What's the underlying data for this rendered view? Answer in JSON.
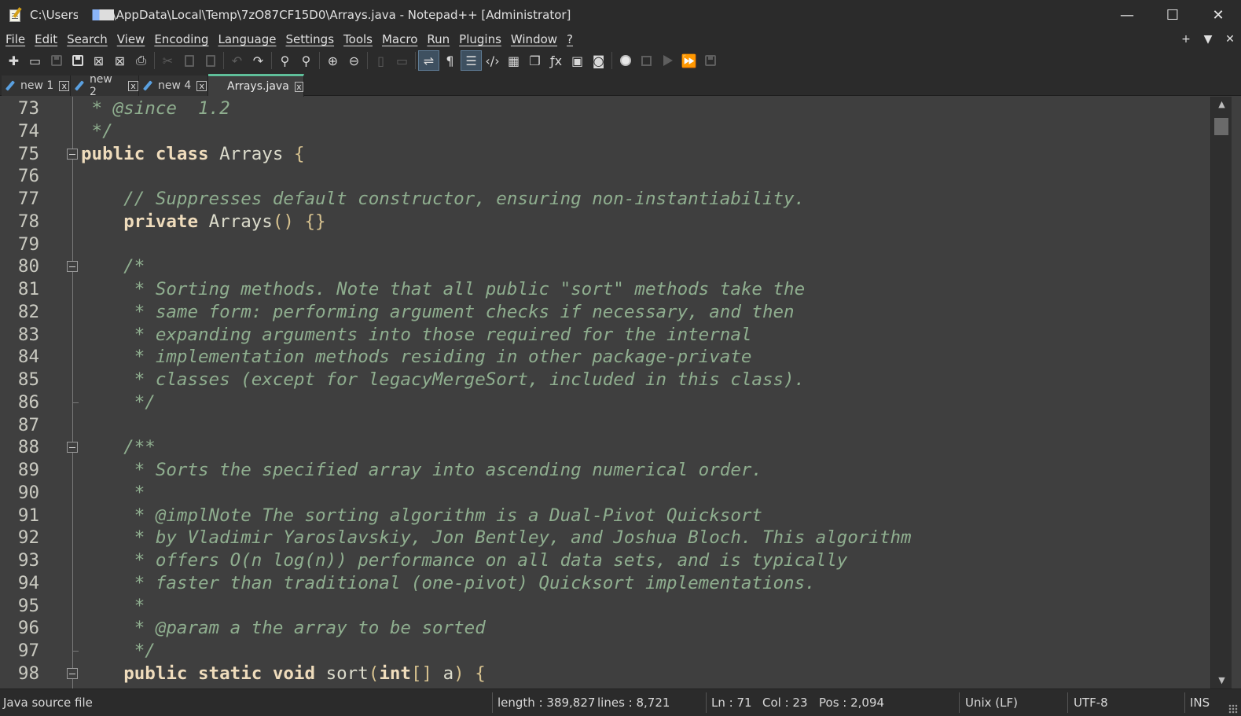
{
  "window": {
    "title_prefix": "C:\\Users",
    "title_suffix": "\\AppData\\Local\\Temp\\7zO87CF15D0\\Arrays.java - Notepad++ [Administrator]",
    "minimize": "—",
    "maximize": "☐",
    "close": "✕"
  },
  "menu": {
    "items": [
      "File",
      "Edit",
      "Search",
      "View",
      "Encoding",
      "Language",
      "Settings",
      "Tools",
      "Macro",
      "Run",
      "Plugins",
      "Window",
      "?"
    ],
    "right_plus": "+",
    "right_down": "▼",
    "right_close": "✕"
  },
  "toolbar": {
    "icons": [
      "new-file-icon",
      "open-file-icon",
      "save-icon",
      "save-all-icon",
      "close-icon",
      "close-all-icon",
      "print-icon",
      "cut-icon",
      "copy-icon",
      "paste-icon",
      "undo-icon",
      "redo-icon",
      "find-icon",
      "replace-icon",
      "zoom-in-icon",
      "zoom-out-icon",
      "sync-vertical-icon",
      "sync-horizontal-icon",
      "word-wrap-icon",
      "show-all-chars-icon",
      "indent-guide-icon",
      "xml-tag-icon",
      "document-map-icon",
      "document-list-icon",
      "function-list-icon",
      "monitoring-icon",
      "screenshot-icon",
      "record-macro-icon",
      "stop-macro-icon",
      "play-macro-icon",
      "run-macro-multiple-icon",
      "save-macro-icon"
    ]
  },
  "tabs": [
    {
      "label": "new 1",
      "close": "x"
    },
    {
      "label": "new 2",
      "close": "x"
    },
    {
      "label": "new 4",
      "close": "x"
    },
    {
      "label": "Arrays.java",
      "close": "x"
    }
  ],
  "editor": {
    "lines": [
      {
        "n": "73",
        "text": " * @since  1.2"
      },
      {
        "n": "74",
        "text": " */"
      },
      {
        "n": "75",
        "text": "public class Arrays {"
      },
      {
        "n": "76",
        "text": ""
      },
      {
        "n": "77",
        "text": "    // Suppresses default constructor, ensuring non-instantiability."
      },
      {
        "n": "78",
        "text": "    private Arrays() {}"
      },
      {
        "n": "79",
        "text": ""
      },
      {
        "n": "80",
        "text": "    /*"
      },
      {
        "n": "81",
        "text": "     * Sorting methods. Note that all public \"sort\" methods take the"
      },
      {
        "n": "82",
        "text": "     * same form: performing argument checks if necessary, and then"
      },
      {
        "n": "83",
        "text": "     * expanding arguments into those required for the internal"
      },
      {
        "n": "84",
        "text": "     * implementation methods residing in other package-private"
      },
      {
        "n": "85",
        "text": "     * classes (except for legacyMergeSort, included in this class)."
      },
      {
        "n": "86",
        "text": "     */"
      },
      {
        "n": "87",
        "text": ""
      },
      {
        "n": "88",
        "text": "    /**"
      },
      {
        "n": "89",
        "text": "     * Sorts the specified array into ascending numerical order."
      },
      {
        "n": "90",
        "text": "     *"
      },
      {
        "n": "91",
        "text": "     * @implNote The sorting algorithm is a Dual-Pivot Quicksort"
      },
      {
        "n": "92",
        "text": "     * by Vladimir Yaroslavskiy, Jon Bentley, and Joshua Bloch. This algorithm"
      },
      {
        "n": "93",
        "text": "     * offers O(n log(n)) performance on all data sets, and is typically"
      },
      {
        "n": "94",
        "text": "     * faster than traditional (one-pivot) Quicksort implementations."
      },
      {
        "n": "95",
        "text": "     *"
      },
      {
        "n": "96",
        "text": "     * @param a the array to be sorted"
      },
      {
        "n": "97",
        "text": "     */"
      },
      {
        "n": "98",
        "text": "    public static void sort(int[] a) {"
      }
    ]
  },
  "status": {
    "file_type": "Java source file",
    "length": "length : 389,827",
    "lines": "lines : 8,721",
    "ln": "Ln : 71",
    "col": "Col : 23",
    "pos": "Pos : 2,094",
    "eol": "Unix (LF)",
    "encoding": "UTF-8",
    "mode": "INS"
  },
  "colors": {
    "background": "#3f3f3f",
    "keyword": "#efdcbc",
    "comment": "#8fae8f",
    "bracket": "#d7c28f",
    "active_tab_accent": "#5fbf9a"
  }
}
